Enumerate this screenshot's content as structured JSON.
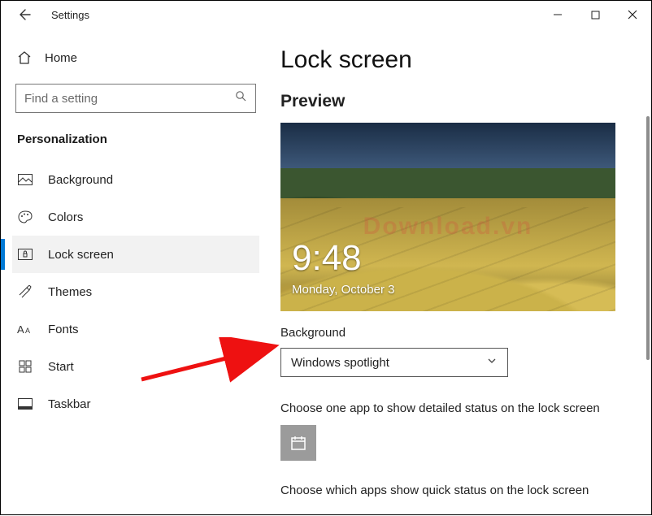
{
  "titlebar": {
    "app_title": "Settings"
  },
  "sidebar": {
    "home_label": "Home",
    "search_placeholder": "Find a setting",
    "section_title": "Personalization",
    "items": [
      {
        "label": "Background"
      },
      {
        "label": "Colors"
      },
      {
        "label": "Lock screen"
      },
      {
        "label": "Themes"
      },
      {
        "label": "Fonts"
      },
      {
        "label": "Start"
      },
      {
        "label": "Taskbar"
      }
    ]
  },
  "content": {
    "page_title": "Lock screen",
    "preview_heading": "Preview",
    "lock_time": "9:48",
    "lock_date": "Monday, October 3",
    "watermark": "Download.vn",
    "background_label": "Background",
    "background_value": "Windows spotlight",
    "detailed_status_text": "Choose one app to show detailed status on the lock screen",
    "quick_status_text": "Choose which apps show quick status on the lock screen"
  }
}
